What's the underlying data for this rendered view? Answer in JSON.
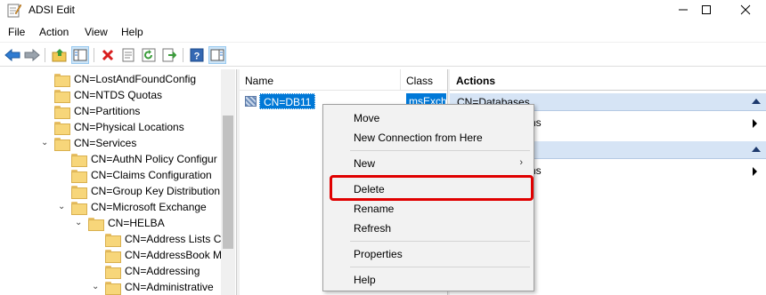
{
  "window": {
    "title": "ADSI Edit"
  },
  "menu": [
    "File",
    "Action",
    "View",
    "Help"
  ],
  "toolbar": [
    "back-icon",
    "forward-icon",
    "up-folder-icon",
    "show-hide-tree-icon",
    "delete-icon",
    "properties-icon",
    "refresh-icon",
    "export-list-icon",
    "help-icon",
    "show-hide-action-pane-icon"
  ],
  "tree": [
    {
      "label": "CN=LostAndFoundConfig",
      "expander": ""
    },
    {
      "label": "CN=NTDS Quotas",
      "expander": ""
    },
    {
      "label": "CN=Partitions",
      "expander": ""
    },
    {
      "label": "CN=Physical Locations",
      "expander": ""
    },
    {
      "label": "CN=Services",
      "expander": "v"
    },
    {
      "label": "CN=AuthN Policy Configur",
      "expander": ""
    },
    {
      "label": "CN=Claims Configuration",
      "expander": ""
    },
    {
      "label": "CN=Group Key Distribution",
      "expander": ""
    },
    {
      "label": "CN=Microsoft Exchange",
      "expander": "v"
    },
    {
      "label": "CN=HELBA",
      "expander": "v"
    },
    {
      "label": "CN=Address Lists Co",
      "expander": ""
    },
    {
      "label": "CN=AddressBook M",
      "expander": ""
    },
    {
      "label": "CN=Addressing",
      "expander": ""
    },
    {
      "label": "CN=Administrative",
      "expander": "v"
    }
  ],
  "list": {
    "headers": {
      "name": "Name",
      "class": "Class"
    },
    "rows": [
      {
        "name": "CN=DB11",
        "class": "msExchM"
      }
    ]
  },
  "actions": {
    "title": "Actions",
    "section1": "CN=Databases",
    "item1": "More Actions",
    "item1_visible": "ns",
    "item2_visible": "ns"
  },
  "context_menu": {
    "items": [
      "Move",
      "New Connection from Here",
      "New",
      "Delete",
      "Rename",
      "Refresh",
      "Properties",
      "Help"
    ],
    "highlighted": "Delete",
    "highlight_color": "#e00000"
  },
  "colors": {
    "selection": "#0078d7",
    "action_header": "#d6e4f5"
  }
}
